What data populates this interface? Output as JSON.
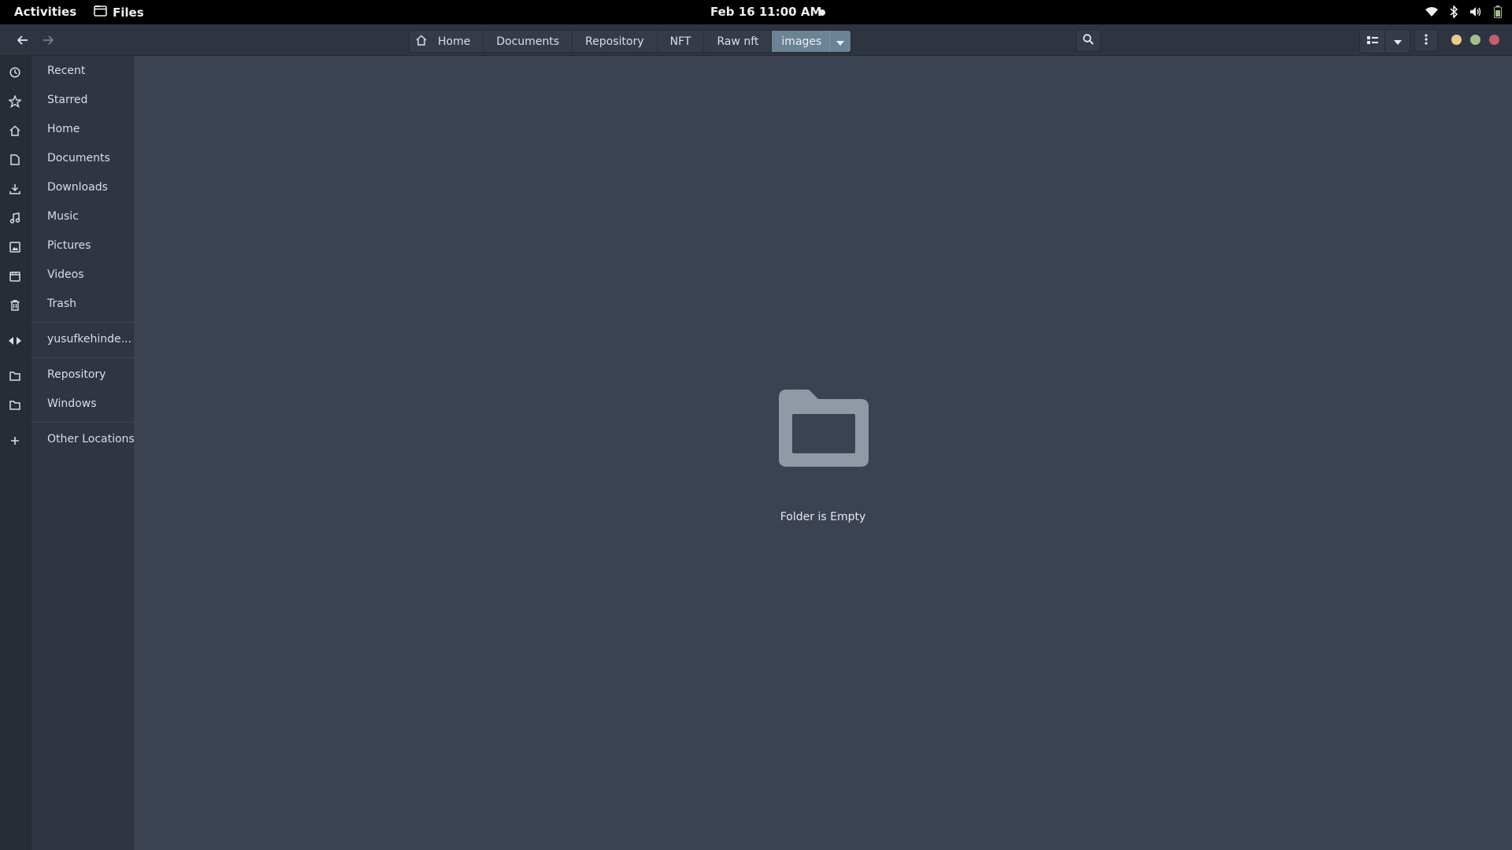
{
  "topbar": {
    "activities": "Activities",
    "app_name": "Files",
    "clock": "Feb 16  11:00 AM"
  },
  "header": {
    "breadcrumbs": [
      "Home",
      "Documents",
      "Repository",
      "NFT",
      "Raw nft",
      "images"
    ],
    "active_crumb": "images"
  },
  "sidebar": {
    "items": [
      {
        "label": "Recent",
        "icon": "clock-icon"
      },
      {
        "label": "Starred",
        "icon": "star-icon"
      },
      {
        "label": "Home",
        "icon": "home-icon"
      },
      {
        "label": "Documents",
        "icon": "document-icon"
      },
      {
        "label": "Downloads",
        "icon": "download-icon"
      },
      {
        "label": "Music",
        "icon": "music-icon"
      },
      {
        "label": "Pictures",
        "icon": "picture-icon"
      },
      {
        "label": "Videos",
        "icon": "video-icon"
      },
      {
        "label": "Trash",
        "icon": "trash-icon"
      }
    ],
    "network": [
      {
        "label": "yusufkehinde...",
        "icon": "network-share-icon"
      }
    ],
    "bookmarks": [
      {
        "label": "Repository",
        "icon": "folder-icon"
      },
      {
        "label": "Windows",
        "icon": "folder-icon"
      }
    ],
    "other": {
      "label": "Other Locations",
      "icon": "plus-icon"
    }
  },
  "main": {
    "empty_message": "Folder is Empty"
  },
  "colors": {
    "window_minimize": "#ebcb8b",
    "window_maximize": "#a3be8c",
    "window_close": "#bf616a",
    "active_crumb": "#6a8395",
    "content_bg": "#3b4252"
  }
}
